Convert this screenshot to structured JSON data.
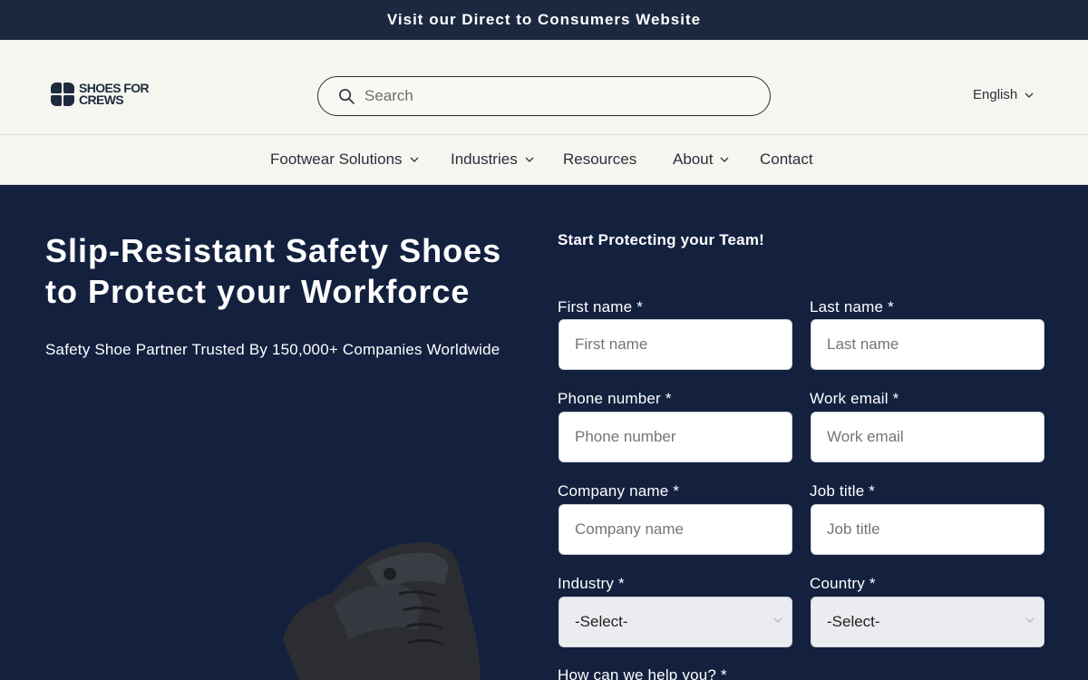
{
  "announcement": {
    "text": "Visit our Direct to Consumers Website"
  },
  "header": {
    "logo_line1": "SHOES FOR",
    "logo_line2": "CREWS",
    "search_placeholder": "Search",
    "language": "English"
  },
  "nav": {
    "items": [
      {
        "label": "Footwear Solutions",
        "has_dropdown": true
      },
      {
        "label": "Industries",
        "has_dropdown": true
      },
      {
        "label": "Resources",
        "has_dropdown": false
      },
      {
        "label": "About",
        "has_dropdown": true
      },
      {
        "label": "Contact",
        "has_dropdown": false
      }
    ]
  },
  "hero": {
    "title": "Slip-Resistant Safety Shoes to Protect your Workforce",
    "subtitle": "Safety Shoe Partner Trusted By 150,000+ Companies Worldwide"
  },
  "form": {
    "title": "Start Protecting your Team!",
    "first_name": {
      "label": "First name *",
      "placeholder": "First name"
    },
    "last_name": {
      "label": "Last name *",
      "placeholder": "Last name"
    },
    "phone": {
      "label": "Phone number *",
      "placeholder": "Phone number"
    },
    "email": {
      "label": "Work email *",
      "placeholder": "Work email"
    },
    "company": {
      "label": "Company name *",
      "placeholder": "Company name"
    },
    "job_title": {
      "label": "Job title *",
      "placeholder": "Job title"
    },
    "industry": {
      "label": "Industry *",
      "value": "-Select-"
    },
    "country": {
      "label": "Country *",
      "value": "-Select-"
    },
    "help": {
      "label": "How can we help you? *"
    }
  },
  "colors": {
    "announce_bg": "#1b2940",
    "header_bg": "#f6f6f1",
    "hero_bg": "#13213f",
    "text_dark": "#2a2f3a"
  }
}
